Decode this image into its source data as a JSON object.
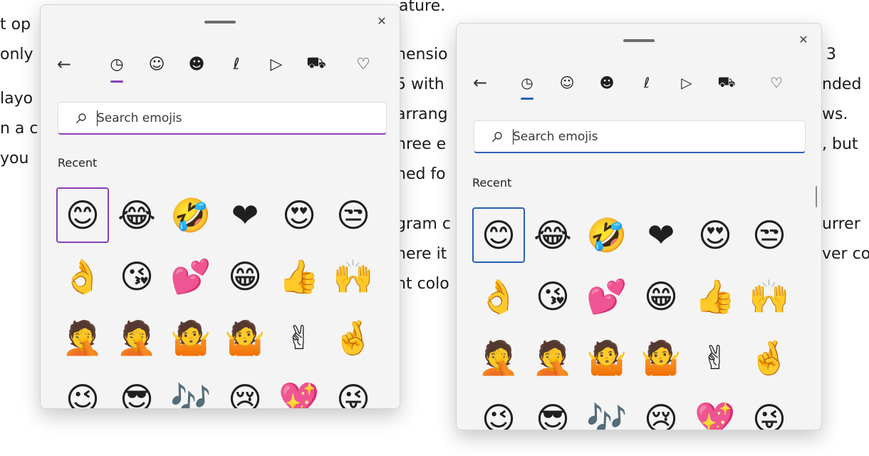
{
  "document": {
    "left_lines": [
      "t op",
      "only",
      "layo",
      "n a c",
      "you"
    ],
    "middle_lines": [
      "ature.",
      "nensio",
      "5 with",
      "arrang",
      "hree e",
      "hed fo",
      "gram c",
      "nere it",
      "nt colo"
    ],
    "right_lines": [
      "3",
      "nded",
      "ws.",
      ", but",
      "urrer",
      "ver co"
    ]
  },
  "panels": [
    {
      "id": "left",
      "accent": "#8a3fb8",
      "close_glyph": "✕",
      "back_glyph": "←",
      "tabs": [
        {
          "icon": "clock-icon",
          "glyph": "◷"
        },
        {
          "icon": "smiley-icon",
          "glyph": "☺"
        },
        {
          "icon": "person-icon",
          "glyph": "☻"
        },
        {
          "icon": "map-pin-icon",
          "glyph": "ℓ"
        },
        {
          "icon": "pizza-icon",
          "glyph": "▷"
        },
        {
          "icon": "car-icon",
          "glyph": "⛟"
        },
        {
          "icon": "heart-icon",
          "glyph": "♡"
        }
      ],
      "search": {
        "placeholder": "Search emojis"
      },
      "section": "Recent",
      "emojis": [
        "😊",
        "😂",
        "🤣",
        "❤",
        "😍",
        "😒",
        "👌",
        "😘",
        "💕",
        "😁",
        "👍",
        "🙌",
        "🤦",
        "🤦",
        "🤷",
        "🤷",
        "✌",
        "🤞",
        "😉",
        "😎",
        "🎶",
        "😢",
        "💖",
        "😜"
      ]
    },
    {
      "id": "right",
      "accent": "#2b5fb7",
      "close_glyph": "✕",
      "back_glyph": "←",
      "tabs": [
        {
          "icon": "clock-icon",
          "glyph": "◷"
        },
        {
          "icon": "smiley-icon",
          "glyph": "☺"
        },
        {
          "icon": "person-icon",
          "glyph": "☻"
        },
        {
          "icon": "map-pin-icon",
          "glyph": "ℓ"
        },
        {
          "icon": "pizza-icon",
          "glyph": "▷"
        },
        {
          "icon": "car-icon",
          "glyph": "⛟"
        },
        {
          "icon": "heart-icon",
          "glyph": "♡"
        }
      ],
      "search": {
        "placeholder": "Search emojis"
      },
      "section": "Recent",
      "emojis": [
        "😊",
        "😂",
        "🤣",
        "❤",
        "😍",
        "😒",
        "👌",
        "😘",
        "💕",
        "😁",
        "👍",
        "🙌",
        "🤦",
        "🤦",
        "🤷",
        "🤷",
        "✌",
        "🤞",
        "😉",
        "😎",
        "🎶",
        "😢",
        "💖",
        "😜"
      ]
    }
  ]
}
